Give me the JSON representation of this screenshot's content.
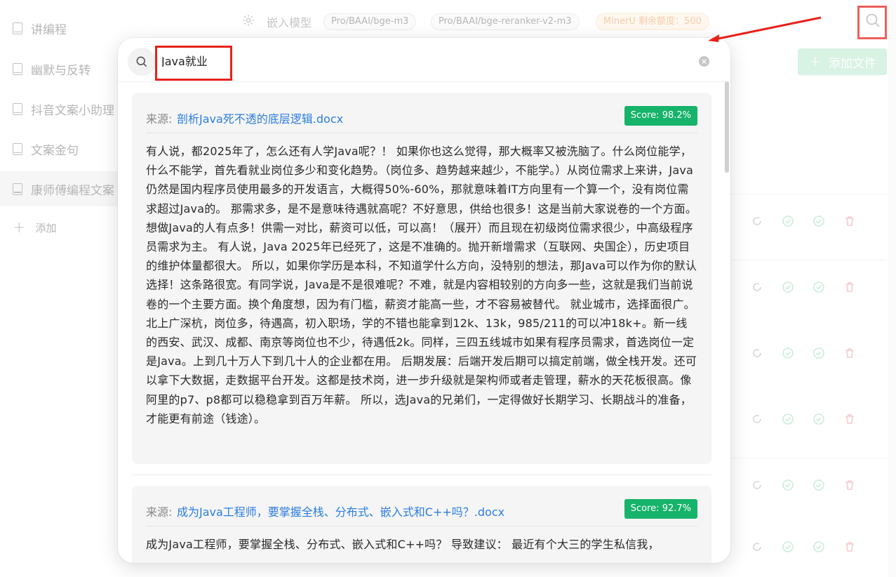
{
  "sidebar": {
    "items": [
      {
        "label": "讲编程"
      },
      {
        "label": "幽默与反转"
      },
      {
        "label": "抖音文案小助理"
      },
      {
        "label": "文案金句"
      },
      {
        "label": "康师傅编程文案"
      }
    ],
    "add_label": "添加"
  },
  "topbar": {
    "embed_label": "嵌入模型",
    "chips": [
      "Pro/BAAI/bge-m3",
      "Pro/BAAI/bge-reranker-v2-m3",
      "MinerU 剩余额度：500"
    ]
  },
  "add_file_label": "添加文件",
  "search": {
    "query": "Java就业"
  },
  "results": [
    {
      "source_label": "来源:",
      "file": "剖析Java死不透的底层逻辑.docx",
      "score": "Score: 98.2%",
      "text": "有人说，都2025年了，怎么还有人学Java呢？！ 如果你也这么觉得，那大概率又被洗脑了。什么岗位能学，什么不能学，首先看就业岗位多少和变化趋势。（岗位多、趋势越来越少，不能学。）从岗位需求上来讲，Java仍然是国内程序员使用最多的开发语言，大概得50%-60%，那就意味着IT方向里有一个算一个，没有岗位需求超过Java的。 那需求多，是不是意味待遇就高呢？不好意思，供给也很多！这是当前大家说卷的一个方面。想做Java的人有点多！供需一对比，薪资可以低，可以高！（展开）而且现在初级岗位需求很少，中高级程序员需求为主。 有人说，Java 2025年已经死了，这是不准确的。抛开新增需求（互联网、央国企），历史项目的维护体量都很大。 所以，如果你学历是本科，不知道学什么方向，没特别的想法，那Java可以作为你的默认选择！这条路很宽。有同学说，Java是不是很难呢？不难，就是内容相较别的方向多一些，这就是我们当前说卷的一个主要方面。换个角度想，因为有门槛，薪资才能高一些，才不容易被替代。 就业城市，选择面很广。北上广深杭，岗位多，待遇高，初入职场，学的不错也能拿到12k、13k，985/211的可以冲18k+。新一线的西安、武汉、成都、南京等岗位也不少，待遇低2k。同样，三四五线城市如果有程序员需求，首选岗位一定是Java。上到几十万人下到几十人的企业都在用。 后期发展：后端开发后期可以搞定前端，做全栈开发。还可以拿下大数据，走数据平台开发。这都是技术岗，进一步升级就是架构师或者走管理，薪水的天花板很高。像阿里的p7、p8都可以稳稳拿到百万年薪。 所以，选Java的兄弟们，一定得做好长期学习、长期战斗的准备，才能更有前途（钱途）。"
    },
    {
      "source_label": "来源:",
      "file": "成为Java工程师，要掌握全栈、分布式、嵌入式和C++吗？.docx",
      "score": "Score: 92.7%",
      "text": "成为Java工程师，要掌握全栈、分布式、嵌入式和C++吗？ 导致建议： 最近有个大三的学生私信我，"
    }
  ],
  "colors": {
    "accent_green": "#16b36a",
    "link_blue": "#2b7de0",
    "annotation_red": "#e8221b"
  }
}
